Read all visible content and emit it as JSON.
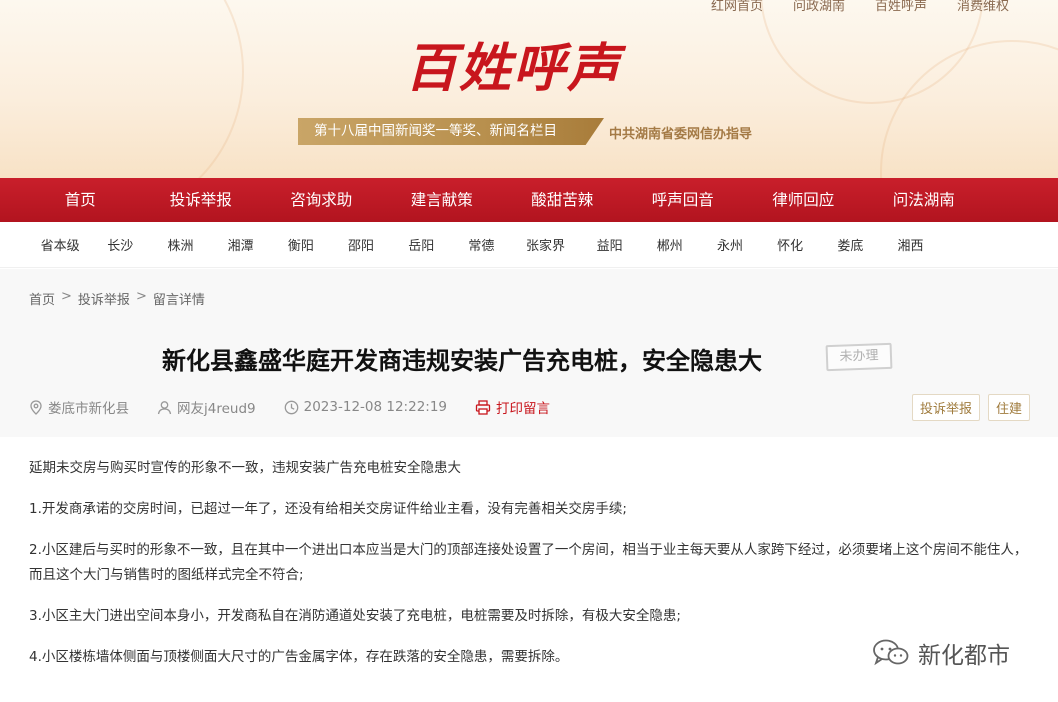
{
  "header": {
    "top_links": [
      "红网首页",
      "问政湖南",
      "百姓呼声",
      "消费维权"
    ],
    "logo_text": "百姓呼声",
    "award": "第十八届中国新闻奖一等奖、新闻名栏目",
    "guide": "中共湖南省委网信办指导"
  },
  "nav": {
    "items": [
      "首页",
      "投诉举报",
      "咨询求助",
      "建言献策",
      "酸甜苦辣",
      "呼声回音",
      "律师回应",
      "问法湖南"
    ]
  },
  "cities": {
    "items": [
      "省本级",
      "长沙",
      "株洲",
      "湘潭",
      "衡阳",
      "邵阳",
      "岳阳",
      "常德",
      "张家界",
      "益阳",
      "郴州",
      "永州",
      "怀化",
      "娄底",
      "湘西"
    ]
  },
  "breadcrumb": {
    "home": "首页",
    "section": "投诉举报",
    "current": "留言详情",
    "separator": ">"
  },
  "article": {
    "title": "新化县鑫盛华庭开发商违规安装广告充电桩，安全隐患大",
    "status": "未办理",
    "location": "娄底市新化县",
    "author": "网友j4reud9",
    "time": "2023-12-08 12:22:19",
    "print_label": "打印留言",
    "tags": [
      "投诉举报",
      "住建"
    ],
    "paragraphs": [
      "延期未交房与购买时宣传的形象不一致，违规安装广告充电桩安全隐患大",
      "1.开发商承诺的交房时间，已超过一年了，还没有给相关交房证件给业主看，没有完善相关交房手续;",
      "2.小区建后与买时的形象不一致，且在其中一个进出口本应当是大门的顶部连接处设置了一个房间，相当于业主每天要从人家跨下经过，必须要堵上这个房间不能住人，而且这个大门与销售时的图纸样式完全不符合;",
      "3.小区主大门进出空间本身小，开发商私自在消防通道处安装了充电桩，电桩需要及时拆除，有极大安全隐患;",
      "4.小区楼栋墙体侧面与顶楼侧面大尺寸的广告金属字体，存在跌落的安全隐患，需要拆除。"
    ]
  },
  "watermark": {
    "icon": "wechat-icon",
    "text": "新化都市"
  },
  "colors": {
    "nav_red": "#b2141f",
    "brand_red": "#c8161d",
    "gold": "#b8904e"
  }
}
